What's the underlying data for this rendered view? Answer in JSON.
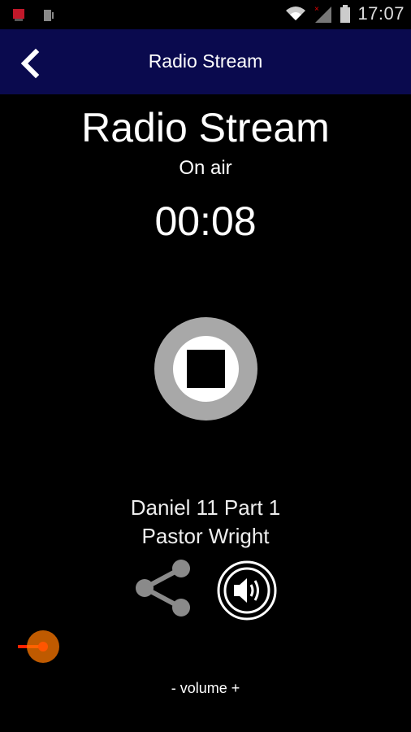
{
  "status_bar": {
    "time": "17:07",
    "icons": [
      "notification-icon",
      "vibrate-icon",
      "wifi-icon",
      "signal-icon",
      "battery-icon"
    ]
  },
  "app_bar": {
    "back_icon": "back-chevron-icon",
    "title": "Radio Stream",
    "color": "#0a0a4e"
  },
  "player": {
    "title": "Radio Stream",
    "status": "On air",
    "elapsed": "00:08",
    "stop_icon": "stop-icon"
  },
  "track": {
    "title": "Daniel 11 Part 1",
    "artist": "Pastor Wright"
  },
  "actions": {
    "share_icon": "share-icon",
    "volume_icon": "speaker-icon"
  },
  "volume": {
    "label": "- volume +",
    "level": 0.02,
    "accent": "#ff5500"
  }
}
